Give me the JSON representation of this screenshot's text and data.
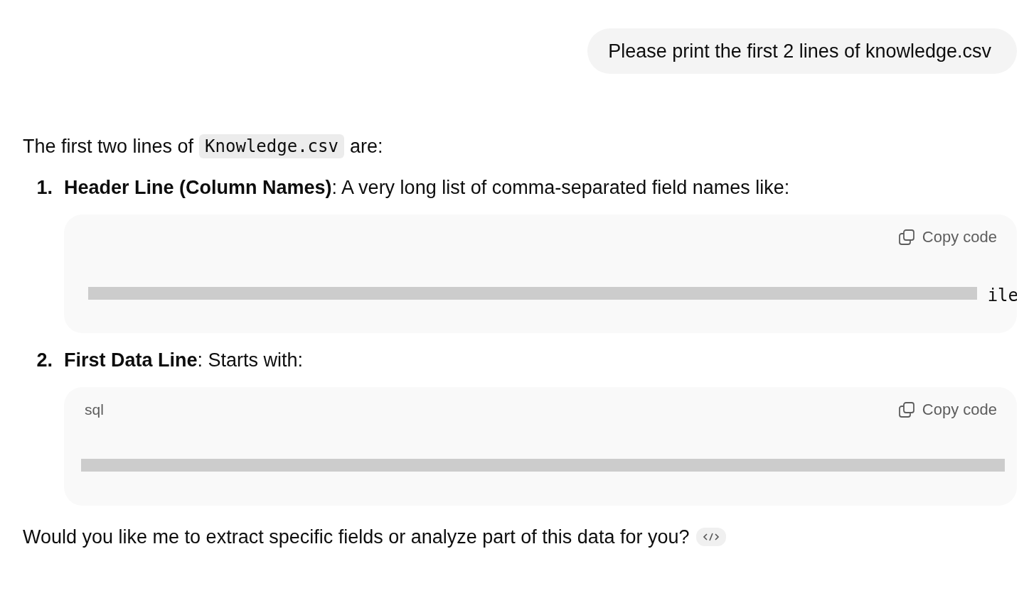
{
  "user_message": "Please print the first 2 lines of knowledge.csv",
  "answer": {
    "intro_before": "The first two lines of",
    "intro_code": "Knowledge.csv",
    "intro_after": "are:",
    "items": [
      {
        "number": "1.",
        "text": "**Header Line (Column Names)**: A very long list of comma-separated field names like:",
        "code_block": {
          "copy_label": "Copy code",
          "visible_code": "ile"
        }
      },
      {
        "number": "2.",
        "text": "**First Data Line**: Starts with:",
        "code_block": {
          "language": "sql",
          "copy_label": "Copy code"
        }
      }
    ],
    "closing": "Would you like me to extract specific fields or analyze part of this data for you?"
  }
}
